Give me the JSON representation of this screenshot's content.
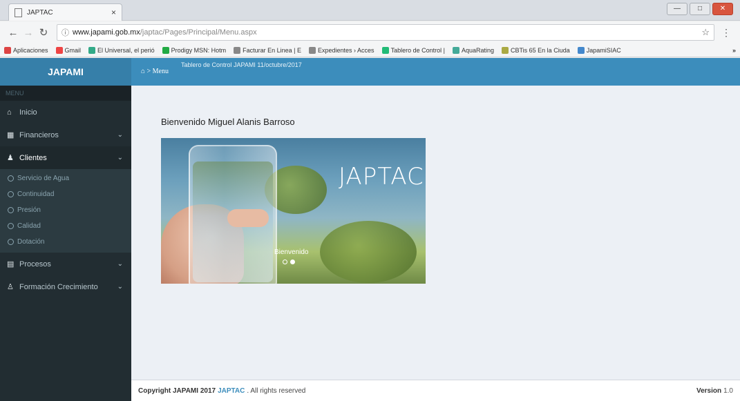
{
  "browser": {
    "tab_title": "JAPTAC",
    "tab_close": "×",
    "window_buttons": [
      "—",
      "□",
      "✕"
    ],
    "url_host": "www.japami.gob.mx",
    "url_path": "/japtac/Pages/Principal/Menu.aspx",
    "bookmarks": [
      {
        "label": "Aplicaciones",
        "color": "#d44"
      },
      {
        "label": "Gmail",
        "color": "#e44"
      },
      {
        "label": "El Universal, el perió",
        "color": "#3a8"
      },
      {
        "label": "Prodigy MSN: Hotm",
        "color": "#2a4"
      },
      {
        "label": "Facturar En Linea | E",
        "color": "#888"
      },
      {
        "label": "Expedientes › Acces",
        "color": "#888"
      },
      {
        "label": "Tablero de Control |",
        "color": "#2b7"
      },
      {
        "label": "AquaRating",
        "color": "#4a9"
      },
      {
        "label": "CBTis 65 En la Ciuda",
        "color": "#aa4"
      },
      {
        "label": "JapamiSIAC",
        "color": "#48c"
      }
    ],
    "bookmarks_more": "»"
  },
  "header": {
    "logo": "JAPAMI",
    "breadcrumb": "⌂ > Menu",
    "title": "Tablero de Control JAPAMI 11/octubre/2017"
  },
  "sidebar": {
    "header": "MENU",
    "items": [
      {
        "label": "Inicio",
        "icon": "home-icon",
        "glyph": "⌂",
        "chevron": ""
      },
      {
        "label": "Financieros",
        "icon": "table-icon",
        "glyph": "▦",
        "chevron": "⌄"
      },
      {
        "label": "Clientes",
        "icon": "user-icon",
        "glyph": "♟",
        "chevron": "⌄"
      }
    ],
    "clientes_sub": [
      {
        "label": "Servicio de Agua"
      },
      {
        "label": "Continuidad"
      },
      {
        "label": "Presión"
      },
      {
        "label": "Calidad"
      },
      {
        "label": "Dotación"
      }
    ],
    "items_after": [
      {
        "label": "Procesos",
        "icon": "calendar-icon",
        "glyph": "▤",
        "chevron": "⌄"
      },
      {
        "label": "Formación Crecimiento",
        "icon": "user-growth-icon",
        "glyph": "♙",
        "chevron": "⌄"
      }
    ]
  },
  "main": {
    "welcome": "Bienvenido Miguel Alanis Barroso",
    "carousel": {
      "title": "JAPTAC",
      "caption": "Bienvenido",
      "slides": 2,
      "active": 1
    }
  },
  "footer": {
    "copyright": "Copyright JAPAMI 2017",
    "brand": "JAPTAC",
    "rights": ". All rights reserved",
    "version_label": "Version",
    "version_num": "1.0"
  }
}
